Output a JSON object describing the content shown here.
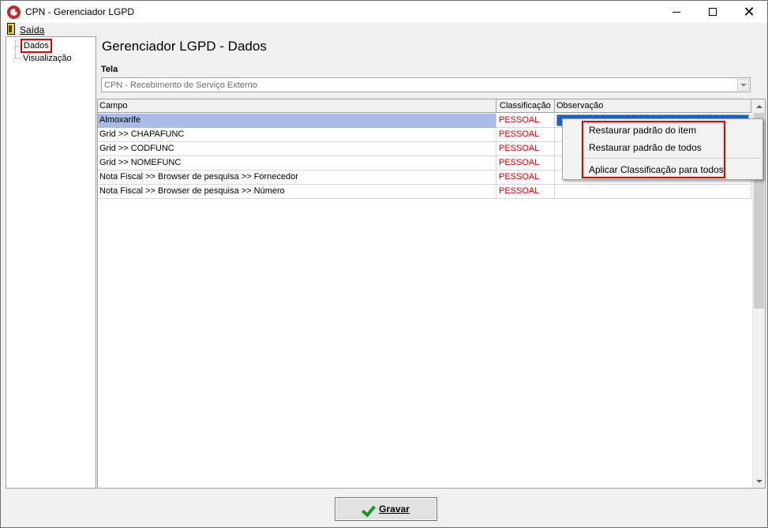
{
  "window": {
    "title": "CPN - Gerenciador LGPD",
    "controls": {
      "minimize": "minimize-icon",
      "maximize": "maximize-icon",
      "close": "close-icon"
    }
  },
  "menu": {
    "exit_label": "Saída"
  },
  "tree": {
    "items": [
      {
        "label": "Dados",
        "highlighted": true
      },
      {
        "label": "Visualização"
      }
    ]
  },
  "main": {
    "heading": "Gerenciador LGPD - Dados",
    "tela_label": "Tela",
    "tela_value": "CPN - Recebimento de Serviço Externo"
  },
  "grid": {
    "columns": [
      "Campo",
      "Classificação",
      "Observação"
    ],
    "rows": [
      {
        "campo": "Almoxarife",
        "classificacao": "PESSOAL",
        "observacao": ""
      },
      {
        "campo": "Grid >> CHAPAFUNC",
        "classificacao": "PESSOAL",
        "observacao": ""
      },
      {
        "campo": "Grid >> CODFUNC",
        "classificacao": "PESSOAL",
        "observacao": ""
      },
      {
        "campo": "Grid >> NOMEFUNC",
        "classificacao": "PESSOAL",
        "observacao": ""
      },
      {
        "campo": "Nota Fiscal >> Browser de pesquisa >> Fornecedor",
        "classificacao": "PESSOAL",
        "observacao": ""
      },
      {
        "campo": "Nota Fiscal >> Browser de pesquisa >> Número",
        "classificacao": "PESSOAL",
        "observacao": ""
      }
    ],
    "selected_row": 0
  },
  "context_menu": {
    "items": [
      "Restaurar padrão do item",
      "Restaurar padrão de todos",
      "Aplicar Classificação para todos"
    ]
  },
  "footer": {
    "save_label": "Gravar"
  },
  "colors": {
    "highlight_red": "#e00000",
    "classification_red": "#e00000",
    "selection_blue": "#a9bce8",
    "focus_blue": "#1a62c7"
  }
}
